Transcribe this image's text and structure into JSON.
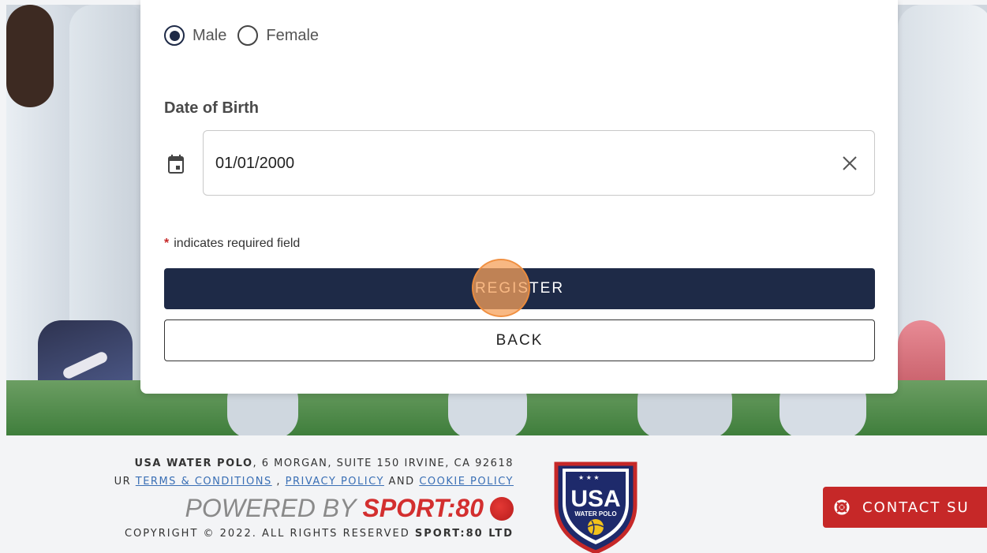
{
  "form": {
    "gender_options": [
      {
        "label": "Male",
        "selected": true
      },
      {
        "label": "Female",
        "selected": false
      }
    ],
    "dob_label": "Date of Birth",
    "dob_value": "01/01/2000",
    "required_note": "indicates required field",
    "required_star": "*",
    "register_label": "REGISTER",
    "back_label": "BACK"
  },
  "footer": {
    "org_name": "USA WATER POLO",
    "address": ", 6 MORGAN, SUITE 150 IRVINE, CA 92618",
    "links_prefix": "UR",
    "terms_label": "TERMS & CONDITIONS",
    "sep1": " , ",
    "privacy_label": "PRIVACY POLICY",
    "and_text": " AND ",
    "cookie_label": "COOKIE POLICY",
    "powered_by": "POWERED BY",
    "sport80": "SPORT:80",
    "copyright": "COPYRIGHT © 2022. ALL RIGHTS RESERVED",
    "copyright_company": "SPORT:80 LTD",
    "logo_text_top": "USA",
    "logo_text_bottom": "WATER POLO",
    "contact_label": "CONTACT SU"
  },
  "colors": {
    "primary": "#1e2a47",
    "contact": "#c62828",
    "link": "#3a6fb5"
  }
}
